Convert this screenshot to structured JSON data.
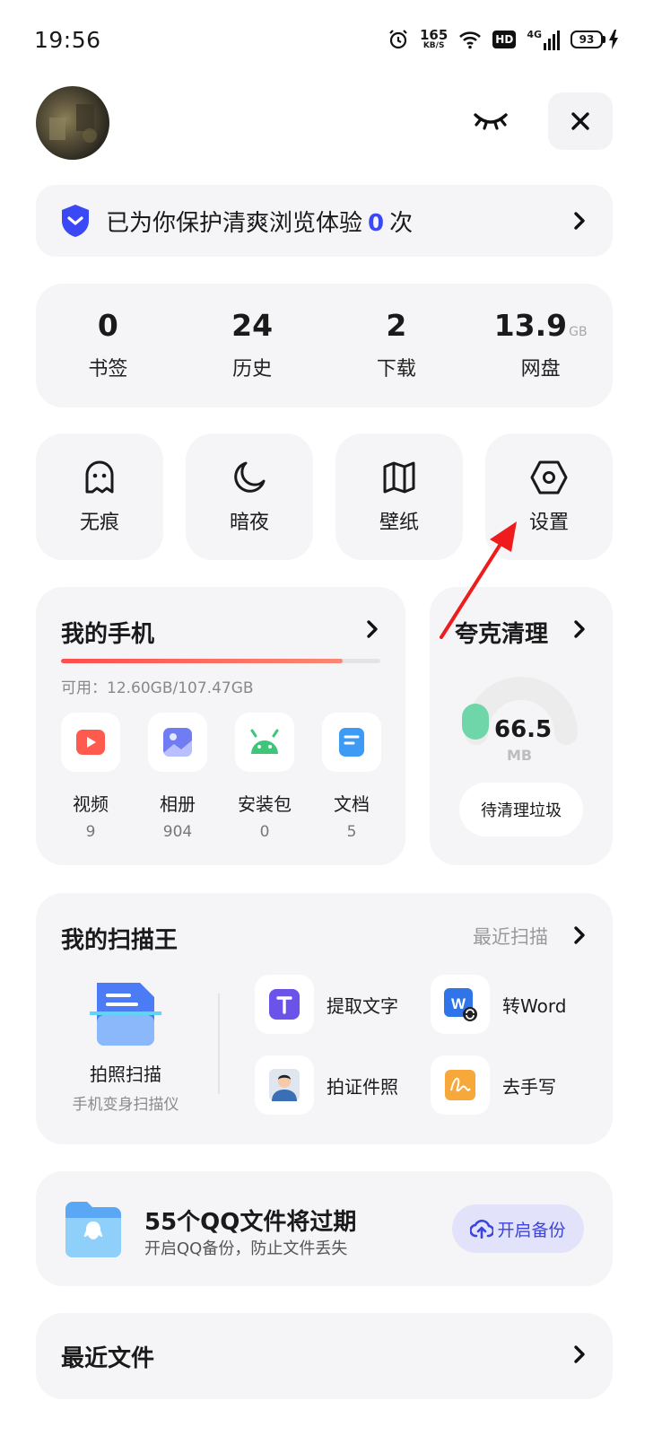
{
  "status_bar": {
    "time": "19:56",
    "net_speed_value": "165",
    "net_speed_unit": "KB/S",
    "hd": "HD",
    "network": "4G",
    "battery": "93"
  },
  "header": {
    "hide_icon": "eye-closed-icon",
    "close_icon": "close-icon"
  },
  "protect": {
    "prefix": "已为你保护清爽浏览体验",
    "count": "0",
    "suffix": "次",
    "accent": "#3a48f5"
  },
  "stats": [
    {
      "value": "0",
      "unit": "",
      "label": "书签"
    },
    {
      "value": "24",
      "unit": "",
      "label": "历史"
    },
    {
      "value": "2",
      "unit": "",
      "label": "下载"
    },
    {
      "value": "13.9",
      "unit": "GB",
      "label": "网盘"
    }
  ],
  "tools": [
    {
      "label": "无痕",
      "icon": "ghost-icon"
    },
    {
      "label": "暗夜",
      "icon": "moon-icon"
    },
    {
      "label": "壁纸",
      "icon": "map-icon"
    },
    {
      "label": "设置",
      "icon": "settings-hexagon-icon"
    }
  ],
  "my_phone": {
    "title": "我的手机",
    "storage_text": "可用：12.60GB/107.47GB",
    "usage_fraction": 0.883,
    "categories": [
      {
        "label": "视频",
        "count": "9",
        "icon": "video-icon"
      },
      {
        "label": "相册",
        "count": "904",
        "icon": "album-icon"
      },
      {
        "label": "安装包",
        "count": "0",
        "icon": "android-icon"
      },
      {
        "label": "文档",
        "count": "5",
        "icon": "document-icon"
      }
    ]
  },
  "clean": {
    "title": "夸克清理",
    "value": "66.5",
    "unit": "MB",
    "button": "待清理垃圾"
  },
  "scanner": {
    "title": "我的扫描王",
    "recent_link": "最近扫描",
    "main_label": "拍照扫描",
    "main_sub": "手机变身扫描仪",
    "items": [
      {
        "label": "提取文字",
        "icon": "extract-text-icon"
      },
      {
        "label": "转Word",
        "icon": "word-icon"
      },
      {
        "label": "拍证件照",
        "icon": "id-photo-icon"
      },
      {
        "label": "去手写",
        "icon": "remove-handwriting-icon"
      }
    ]
  },
  "backup": {
    "title": "55个QQ文件将过期",
    "subtitle": "开启QQ备份，防止文件丢失",
    "button": "开启备份"
  },
  "recent": {
    "title": "最近文件"
  }
}
